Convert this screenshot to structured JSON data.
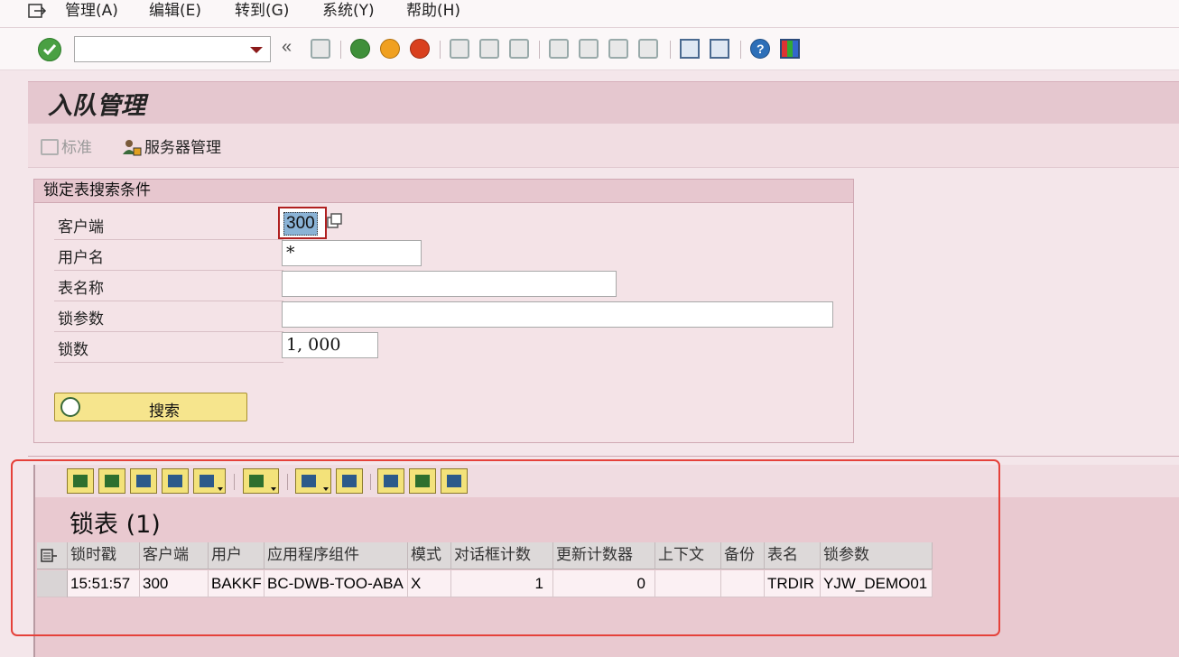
{
  "menu": {
    "items": [
      {
        "label": "管理(A)"
      },
      {
        "label": "编辑(E)"
      },
      {
        "label": "转到(G)"
      },
      {
        "label": "系统(Y)"
      },
      {
        "label": "帮助(H)"
      }
    ]
  },
  "toolbar": {
    "command_value": "",
    "icons": [
      "enter-icon",
      "back-icon",
      "exit-icon",
      "cancel-icon",
      "print-icon",
      "find-icon",
      "find-next-icon",
      "first-page-icon",
      "previous-page-icon",
      "next-page-icon",
      "last-page-icon",
      "new-session-icon",
      "shortcut-icon",
      "help-icon",
      "layout-icon"
    ]
  },
  "title": "入队管理",
  "app_toolbar": {
    "standard_label": "标准",
    "server_label": "服务器管理"
  },
  "search_group": {
    "heading": "锁定表搜索条件",
    "fields": {
      "client_label": "客户端",
      "client_value": "300",
      "user_label": "用户名",
      "user_value": "*",
      "table_label": "表名称",
      "table_value": "",
      "arg_label": "锁参数",
      "arg_value": "",
      "count_label": "锁数",
      "count_value": "1, 000"
    },
    "search_button": "搜索"
  },
  "results": {
    "title": "锁表 (1)",
    "columns": [
      "锁时戳",
      "客户端",
      "用户",
      "应用程序组件",
      "模式",
      "对话框计数",
      "更新计数器",
      "上下文",
      "备份",
      "表名",
      "锁参数"
    ],
    "rows": [
      [
        "15:51:57",
        "300",
        "BAKKF",
        "BC-DWB-TOO-ABA",
        "X",
        "1",
        "0",
        "",
        "",
        "TRDIR",
        "YJW_DEMO01"
      ]
    ]
  },
  "colors": {
    "accent": "#e5c7cf",
    "highlight_frame": "#e5413a",
    "button_yellow": "#f6e58d"
  }
}
